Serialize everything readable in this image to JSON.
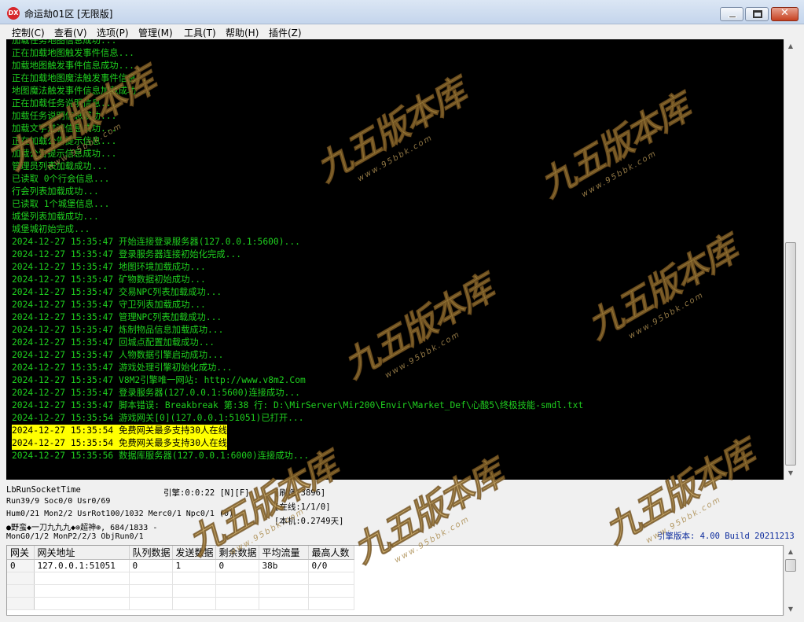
{
  "window": {
    "title": "命运劫01区 [无限版]",
    "icon_text": "DX",
    "close_glyph": "✕"
  },
  "menu": [
    {
      "label": "控制(C)"
    },
    {
      "label": "查看(V)"
    },
    {
      "label": "选项(P)"
    },
    {
      "label": "管理(M)"
    },
    {
      "label": "工具(T)"
    },
    {
      "label": "帮助(H)"
    },
    {
      "label": "插件(Z)"
    }
  ],
  "log": [
    "加载任务地图信息成功...",
    "正在加载地图触发事件信息...",
    "加载地图触发事件信息成功...",
    "正在加载地图魔法触发事件信息...",
    "地图魔法触发事件信息加载成功...",
    "正在加载任务说明信息...",
    "加载任务说明信息成功...",
    "加载文字过滤信息成功...",
    "正在加载公告提示信息...",
    "加载公告提示信息成功...",
    "管理员列表加载成功...",
    "已读取 0个行会信息...",
    "行会列表加载成功...",
    "已读取 1个城堡信息...",
    "城堡列表加载成功...",
    "城堡城初始完成...",
    "2024-12-27 15:35:47 开始连接登录服务器(127.0.0.1:5600)...",
    "2024-12-27 15:35:47 登录服务器连接初始化完成...",
    "2024-12-27 15:35:47 地图环境加载成功...",
    "2024-12-27 15:35:47 矿物数据初始成功...",
    "2024-12-27 15:35:47 交易NPC列表加载成功...",
    "2024-12-27 15:35:47 守卫列表加载成功...",
    "2024-12-27 15:35:47 管理NPC列表加载成功...",
    "2024-12-27 15:35:47 炼制物品信息加载成功...",
    "2024-12-27 15:35:47 回城点配置加载成功...",
    "2024-12-27 15:35:47 人物数据引擎启动成功...",
    "2024-12-27 15:35:47 游戏处理引擎初始化成功...",
    "2024-12-27 15:35:47 V8M2引擎唯一网站: http://www.v8m2.Com",
    "2024-12-27 15:35:47 登录服务器(127.0.0.1:5600)连接成功...",
    "2024-12-27 15:35:47 脚本错误: Breakbreak 第:38 行: D:\\MirServer\\Mir200\\Envir\\Market_Def\\心酸5\\终极技能-smdl.txt",
    "2024-12-27 15:35:54 游戏网关[0](127.0.0.1:51051)已打开...",
    "2024-12-27 15:35:54 免费网关最多支持30人在线",
    "2024-12-27 15:35:54 免费网关最多支持30人在线",
    "2024-12-27 15:35:56 数据库服务器(127.0.0.1:6000)连接成功..."
  ],
  "log_highlight_indices": [
    31,
    32
  ],
  "status": {
    "socket_time": "LbRunSocketTime",
    "run": "Run39/9 Soc0/0 Usr0/69",
    "hum": "Hum0/21 Mon2/2 UsrRot100/1032 Merc0/1 Npc0/1 (0)",
    "player": "●野蛮◆一刀九九九◆⊕超神⊕, 684/1833 -",
    "mon": "MonG0/1/2 MonP2/2/3 ObjRun0/1",
    "engine": "引擎:0:0:22 [N][F]",
    "refresh": "[刷怪:3896]",
    "online": "[在线:1/1/0]",
    "local": "[本机:0.2749天]",
    "engine_version": "引擎版本: 4.00 Build 20211213"
  },
  "table": {
    "headers": [
      "网关",
      "网关地址",
      "队列数据",
      "发送数据",
      "剩余数据",
      "平均流量",
      "最高人数"
    ],
    "rows": [
      [
        "0",
        "127.0.0.1:51051",
        "0",
        "1",
        "0",
        "38b",
        "0/0"
      ],
      [
        "",
        "",
        "",
        "",
        "",
        "",
        ""
      ],
      [
        "",
        "",
        "",
        "",
        "",
        "",
        ""
      ],
      [
        "",
        "",
        "",
        "",
        "",
        "",
        ""
      ]
    ]
  },
  "watermark": {
    "text": "九五版本库",
    "url": "www.95bbk.com"
  },
  "colors": {
    "log_text": "#1fd01f",
    "highlight": "#ffff00",
    "console_bg": "#000000",
    "version_text": "#0a2a9c"
  }
}
